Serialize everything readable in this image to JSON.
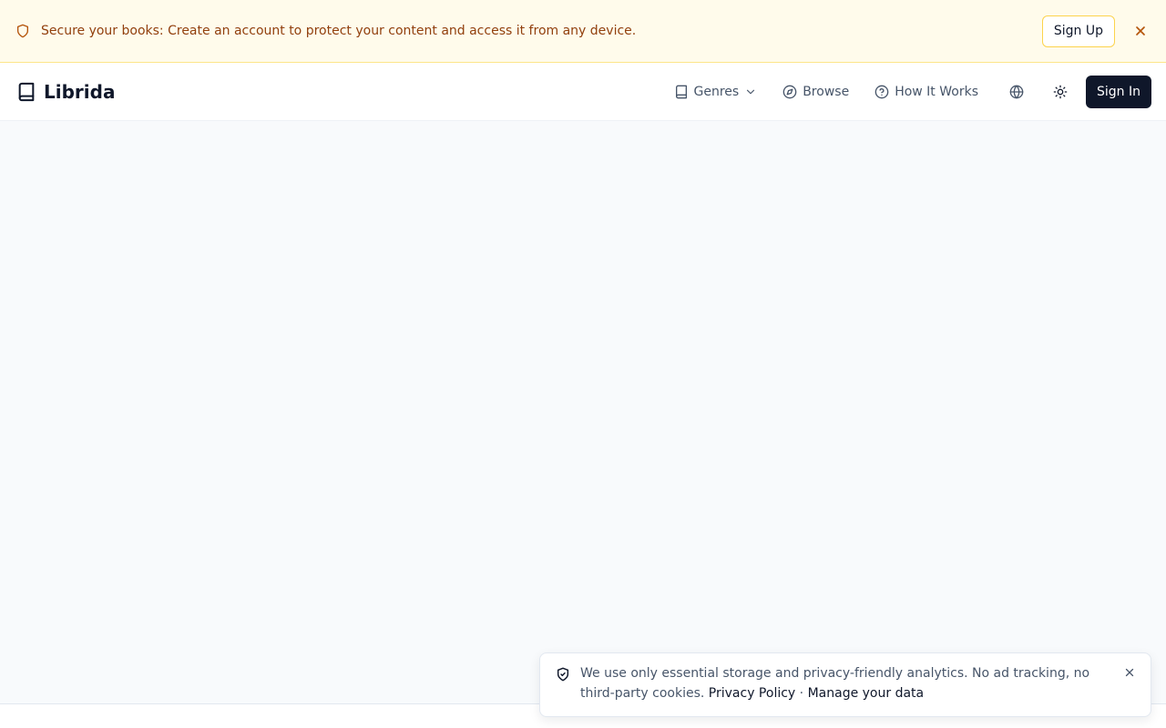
{
  "banner": {
    "icon": "shield-icon",
    "message": "Secure your books: Create an account to protect your content and access it from any device.",
    "signup_label": "Sign Up",
    "close_icon": "close-icon",
    "background": "#fffbeb",
    "text_color": "#92400e"
  },
  "header": {
    "brand": {
      "icon": "book-icon",
      "name": "Librida"
    },
    "nav": {
      "genres": {
        "icon": "book-icon",
        "label": "Genres",
        "chevron": "chevron-down-icon"
      },
      "browse": {
        "icon": "compass-icon",
        "label": "Browse"
      },
      "how_it_works": {
        "icon": "help-circle-icon",
        "label": "How It Works"
      },
      "language_icon": "globe-icon",
      "theme_icon": "sun-icon",
      "signin_label": "Sign In"
    },
    "accent": "#0f172a"
  },
  "cookie": {
    "icon": "shield-check-icon",
    "message": "We use only essential storage and privacy-friendly analytics. No ad tracking, no third-party cookies.",
    "privacy_link": "Privacy Policy",
    "separator": "·",
    "manage_link": "Manage your data",
    "close_icon": "close-icon"
  }
}
